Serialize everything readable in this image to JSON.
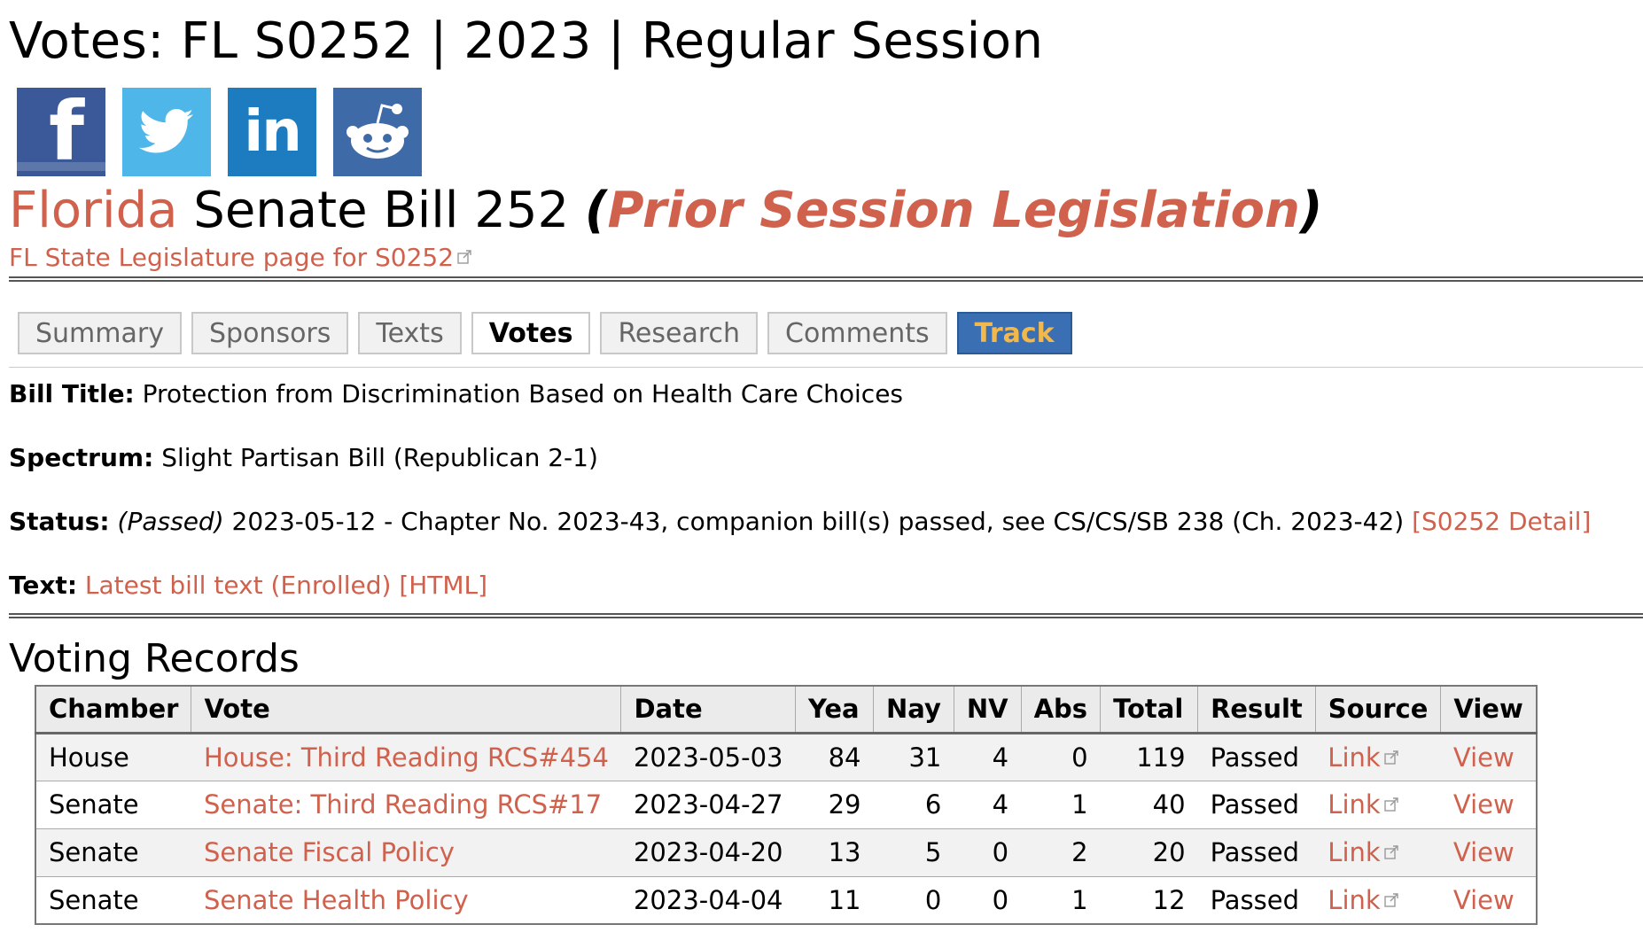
{
  "page_title": "Votes: FL S0252 | 2023 | Regular Session",
  "social": [
    {
      "name": "facebook-icon"
    },
    {
      "name": "twitter-icon"
    },
    {
      "name": "linkedin-icon"
    },
    {
      "name": "reddit-icon"
    }
  ],
  "bill": {
    "state": "Florida",
    "name": "Senate Bill 252",
    "open_paren": "(",
    "prior_label": "Prior Session Legislation",
    "close_paren": ")",
    "legislature_link": "FL State Legislature page for S0252"
  },
  "tabs": [
    {
      "label": "Summary",
      "state": "normal"
    },
    {
      "label": "Sponsors",
      "state": "normal"
    },
    {
      "label": "Texts",
      "state": "normal"
    },
    {
      "label": "Votes",
      "state": "active"
    },
    {
      "label": "Research",
      "state": "normal"
    },
    {
      "label": "Comments",
      "state": "normal"
    },
    {
      "label": "Track",
      "state": "track"
    }
  ],
  "info": {
    "title_label": "Bill Title:",
    "title_value": "Protection from Discrimination Based on Health Care Choices",
    "spectrum_label": "Spectrum:",
    "spectrum_value": "Slight Partisan Bill (Republican 2-1)",
    "status_label": "Status:",
    "status_passed": "(Passed)",
    "status_value": "2023-05-12 - Chapter No. 2023-43, companion bill(s) passed, see CS/CS/SB 238 (Ch. 2023-42)",
    "status_detail_link": "[S0252 Detail]",
    "text_label": "Text:",
    "text_latest_link": "Latest bill text (Enrolled)",
    "text_html_link": "[HTML]"
  },
  "voting_records": {
    "title": "Voting Records",
    "columns": [
      "Chamber",
      "Vote",
      "Date",
      "Yea",
      "Nay",
      "NV",
      "Abs",
      "Total",
      "Result",
      "Source",
      "View"
    ],
    "rows": [
      {
        "chamber": "House",
        "vote": "House: Third Reading RCS#454",
        "date": "2023-05-03",
        "yea": "84",
        "nay": "31",
        "nv": "4",
        "abs": "0",
        "total": "119",
        "result": "Passed",
        "source": "Link",
        "view": "View"
      },
      {
        "chamber": "Senate",
        "vote": "Senate: Third Reading RCS#17",
        "date": "2023-04-27",
        "yea": "29",
        "nay": "6",
        "nv": "4",
        "abs": "1",
        "total": "40",
        "result": "Passed",
        "source": "Link",
        "view": "View"
      },
      {
        "chamber": "Senate",
        "vote": "Senate Fiscal Policy",
        "date": "2023-04-20",
        "yea": "13",
        "nay": "5",
        "nv": "0",
        "abs": "2",
        "total": "20",
        "result": "Passed",
        "source": "Link",
        "view": "View"
      },
      {
        "chamber": "Senate",
        "vote": "Senate Health Policy",
        "date": "2023-04-04",
        "yea": "11",
        "nay": "0",
        "nv": "0",
        "abs": "1",
        "total": "12",
        "result": "Passed",
        "source": "Link",
        "view": "View"
      }
    ]
  },
  "colors": {
    "link": "#d0614c",
    "track_bg": "#3b6fb3",
    "track_text": "#f2b84b",
    "facebook": "#3b5998",
    "twitter": "#4fb6ea",
    "linkedin": "#1d7bbf",
    "reddit": "#3f6aa8"
  }
}
